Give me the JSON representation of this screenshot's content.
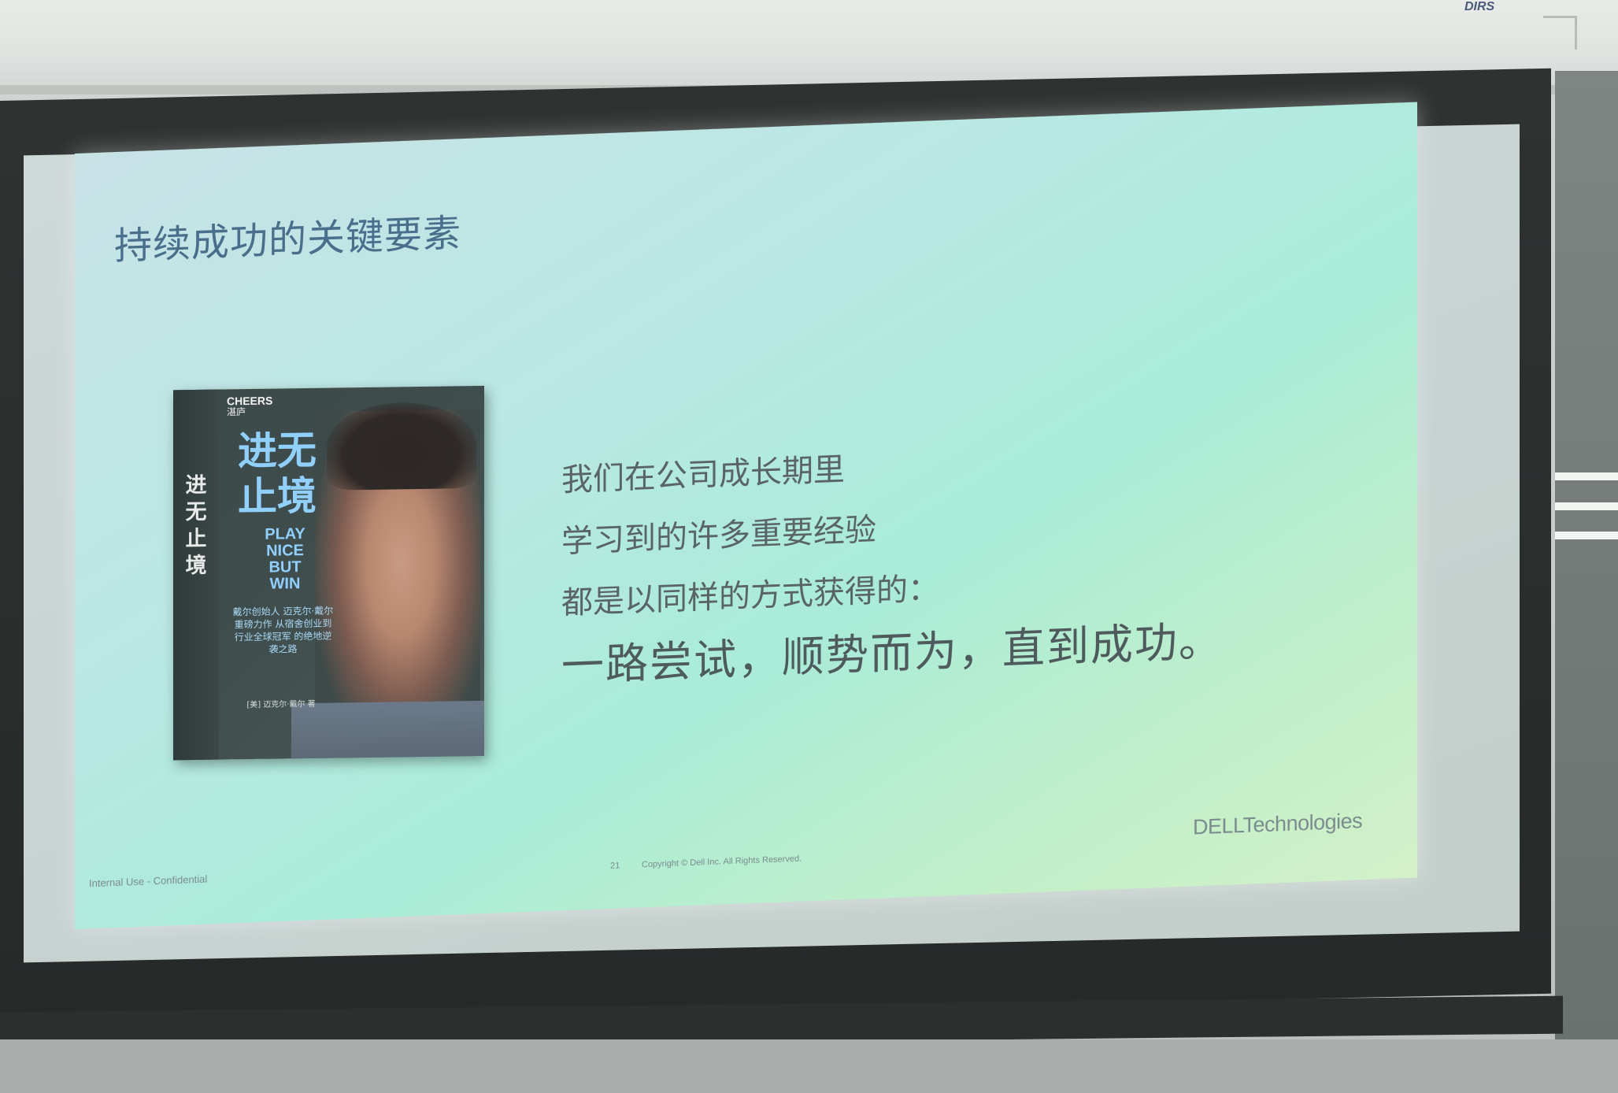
{
  "room": {
    "brand_mark": "DIRS"
  },
  "slide": {
    "title": "持续成功的关键要素",
    "body_lines": [
      "我们在公司成长期里",
      "学习到的许多重要经验",
      "都是以同样的方式获得的："
    ],
    "conclusion": "一路尝试，顺势而为，直到成功。",
    "footer": {
      "classification": "Internal Use - Confidential",
      "page_number": "21",
      "copyright": "Copyright © Dell Inc. All Rights Reserved.",
      "brand": "DELLTechnologies"
    }
  },
  "book": {
    "publisher": "CHEERS",
    "publisher_cn": "湛庐",
    "title_cn": "进无止境",
    "spine_title": "进无止境",
    "title_en": "PLAY NICE BUT WIN",
    "blurb": "戴尔创始人 迈克尔·戴尔 重磅力作 从宿舍创业到行业全球冠军 的绝地逆袭之路",
    "author": "[美] 迈克尔·戴尔 著"
  },
  "colors": {
    "title": "#4a6f8c",
    "body": "#5a6467",
    "book_accent": "#8fd0ff"
  }
}
